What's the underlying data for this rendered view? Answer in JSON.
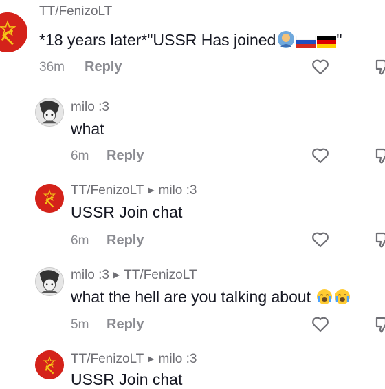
{
  "comments": [
    {
      "author": "TT/FenizoLT",
      "reply_to": "",
      "text": "*18 years later*\"USSR Has joined",
      "text_suffix": "\"",
      "time": "36m",
      "reply_label": "Reply",
      "avatar": "ussr-emblem"
    },
    {
      "author": "milo :3",
      "reply_to": "",
      "text": "what",
      "time": "6m",
      "reply_label": "Reply",
      "avatar": "anime-sketch"
    },
    {
      "author": "TT/FenizoLT",
      "reply_to": "milo :3",
      "text": "USSR Join chat",
      "time": "6m",
      "reply_label": "Reply",
      "avatar": "ussr-emblem"
    },
    {
      "author": "milo :3",
      "reply_to": "TT/FenizoLT",
      "text": "what the hell are you talking about",
      "time": "5m",
      "reply_label": "Reply",
      "avatar": "anime-sketch"
    },
    {
      "author": "TT/FenizoLT",
      "reply_to": "milo :3",
      "text": "USSR Join chat",
      "time": "",
      "reply_label": "",
      "avatar": "ussr-emblem"
    }
  ],
  "colors": {
    "author": "#6f6f75",
    "text": "#161823",
    "meta": "#8a8b91",
    "ussr_red": "#d4221a",
    "ussr_gold": "#f5c518"
  },
  "icons": [
    "heart-icon",
    "dislike-icon",
    "caret-right-icon",
    "ussr-emblem",
    "anime-sketch",
    "emoji-person",
    "flag-russia-icon",
    "flag-germany-icon",
    "crying-face-emoji"
  ]
}
